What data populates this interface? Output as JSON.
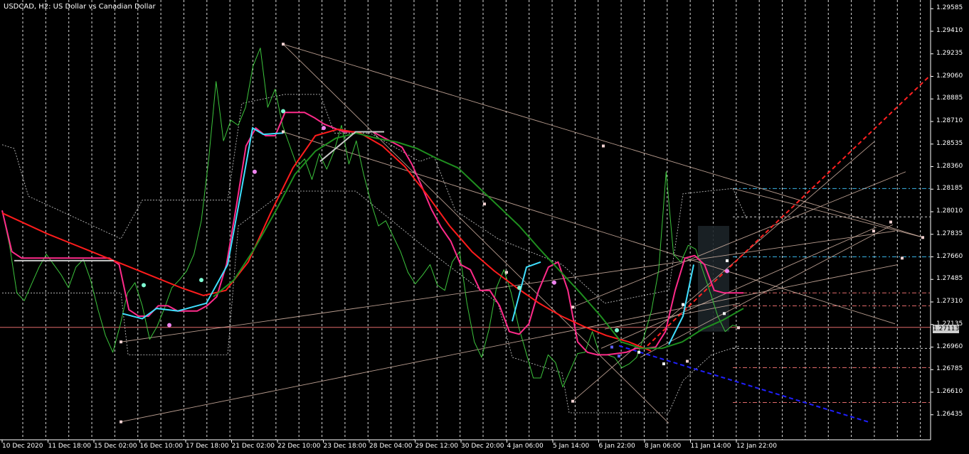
{
  "chart_data": {
    "type": "line",
    "title": "USDCAD, H2:  US Dollar vs Canadian Dollar",
    "symbol": "USDCAD",
    "timeframe": "H2",
    "x_labels": [
      "10 Dec 2020",
      "11 Dec 18:00",
      "15 Dec 02:00",
      "16 Dec 10:00",
      "17 Dec 18:00",
      "21 Dec 02:00",
      "22 Dec 10:00",
      "23 Dec 18:00",
      "28 Dec 04:00",
      "29 Dec 12:00",
      "30 Dec 20:00",
      "4 Jan 06:00",
      "5 Jan 14:00",
      "6 Jan 22:00",
      "8 Jan 06:00",
      "11 Jan 14:00",
      "12 Jan 22:00"
    ],
    "y_ticks": [
      "1.29585",
      "1.29410",
      "1.29235",
      "1.29060",
      "1.28885",
      "1.28710",
      "1.28535",
      "1.28360",
      "1.28185",
      "1.28010",
      "1.27835",
      "1.27660",
      "1.27485",
      "1.27310",
      "1.27135",
      "1.26960",
      "1.26785",
      "1.26610",
      "1.26435"
    ],
    "ylim": [
      1.2637,
      1.2966
    ],
    "current_price": "1.27113",
    "current_price_value": 1.27113,
    "grid": "vertical dashed",
    "series": [
      {
        "key": "price",
        "color": "#3cc43c",
        "values": [
          1.2802,
          1.2775,
          1.2738,
          1.2732,
          1.2745,
          1.2758,
          1.2768,
          1.276,
          1.2752,
          1.2742,
          1.2758,
          1.2764,
          1.2748,
          1.2725,
          1.2705,
          1.2692,
          1.2713,
          1.2738,
          1.2746,
          1.2728,
          1.2702,
          1.2712,
          1.2726,
          1.2742,
          1.2748,
          1.2755,
          1.2768,
          1.2794,
          1.2842,
          1.2902,
          1.2856,
          1.2872,
          1.2868,
          1.2882,
          1.2914,
          1.2928,
          1.2882,
          1.2896,
          1.2868,
          1.2852,
          1.2836,
          1.2842,
          1.2826,
          1.2846,
          1.2834,
          1.2848,
          1.2868,
          1.2838,
          1.2856,
          1.283,
          1.2808,
          1.279,
          1.2794,
          1.2782,
          1.277,
          1.2754,
          1.2745,
          1.2752,
          1.276,
          1.2744,
          1.274,
          1.2762,
          1.277,
          1.273,
          1.27,
          1.2688,
          1.271,
          1.2742,
          1.2756,
          1.2738,
          1.2712,
          1.2692,
          1.2672,
          1.2672,
          1.269,
          1.2684,
          1.2665,
          1.2678,
          1.2691,
          1.2692,
          1.2708,
          1.269,
          1.269,
          1.2688,
          1.268,
          1.2683,
          1.2688,
          1.2704,
          1.2724,
          1.2756,
          1.2832,
          1.2768,
          1.2762,
          1.2775,
          1.2772,
          1.2755,
          1.2738,
          1.272,
          1.2708,
          1.2713,
          1.27113
        ]
      },
      {
        "key": "ma_fast",
        "color": "#ff2b8a",
        "values": [
          1.2802,
          1.277,
          1.2765,
          1.2765,
          1.2765,
          1.2765,
          1.2765,
          1.2765,
          1.2765,
          1.2765,
          1.2765,
          1.2765,
          1.276,
          1.2725,
          1.272,
          1.272,
          1.2728,
          1.2728,
          1.2724,
          1.2724,
          1.2724,
          1.2728,
          1.2735,
          1.276,
          1.2805,
          1.2852,
          1.2866,
          1.286,
          1.286,
          1.2878,
          1.2878,
          1.2878,
          1.2874,
          1.2869,
          1.2866,
          1.2863,
          1.2863,
          1.2863,
          1.2863,
          1.2859,
          1.2855,
          1.2851,
          1.2838,
          1.2821,
          1.2803,
          1.2789,
          1.2778,
          1.276,
          1.2756,
          1.274,
          1.274,
          1.2728,
          1.2708,
          1.2706,
          1.2714,
          1.274,
          1.2758,
          1.2762,
          1.274,
          1.27,
          1.2692,
          1.269,
          1.269,
          1.2691,
          1.2692,
          1.2695,
          1.2695,
          1.2696,
          1.2708,
          1.274,
          1.2765,
          1.2767,
          1.276,
          1.274,
          1.2738,
          1.2738,
          1.2738
        ]
      },
      {
        "key": "ma_slow",
        "color": "#ff1c1c",
        "values": [
          1.28,
          1.2792,
          1.2784,
          1.2777,
          1.277,
          1.2763,
          1.2756,
          1.2749,
          1.2742,
          1.2736,
          1.274,
          1.2762,
          1.28,
          1.2835,
          1.286,
          1.2865,
          1.2862,
          1.2852,
          1.2836,
          1.2814,
          1.279,
          1.277,
          1.2755,
          1.2742,
          1.273,
          1.272,
          1.2712,
          1.2705,
          1.27,
          1.2693
        ]
      },
      {
        "key": "ma_long",
        "color": "#1f8f1f",
        "values": [
          1.2735,
          1.2748,
          1.2772,
          1.28,
          1.283,
          1.2848,
          1.2858,
          1.2862,
          1.2858,
          1.2855,
          1.285,
          1.2842,
          1.2835,
          1.282,
          1.2805,
          1.279,
          1.2772,
          1.2755,
          1.2738,
          1.272,
          1.27,
          1.2695,
          1.2695,
          1.27,
          1.271,
          1.2717,
          1.2726
        ]
      }
    ],
    "horizontal_levels": [
      {
        "value": 1.27113,
        "color": "#e06a6a",
        "style": "solid"
      },
      {
        "value": 1.2819,
        "color": "#39b4e6",
        "style": "dashdot"
      },
      {
        "value": 1.2797,
        "color": "#cfcfcf",
        "style": "dash"
      },
      {
        "value": 1.2766,
        "color": "#39b4e6",
        "style": "dashdot"
      },
      {
        "value": 1.2738,
        "color": "#e06a6a",
        "style": "dashdot"
      },
      {
        "value": 1.2728,
        "color": "#e06a6a",
        "style": "dashdot"
      },
      {
        "value": 1.2695,
        "color": "#cfcfcf",
        "style": "dash"
      },
      {
        "value": 1.268,
        "color": "#e06a6a",
        "style": "dashdot"
      },
      {
        "value": 1.2653,
        "color": "#e06a6a",
        "style": "dashdot"
      }
    ]
  }
}
